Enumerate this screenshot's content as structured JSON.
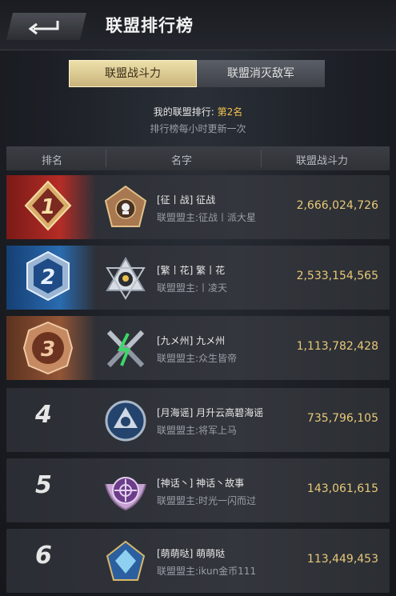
{
  "header": {
    "title": "联盟排行榜"
  },
  "tabs": [
    {
      "label": "联盟战斗力"
    },
    {
      "label": "联盟消灭敌军"
    }
  ],
  "my_rank": {
    "prefix": "我的联盟排行: ",
    "value": "第2名",
    "note": "排行榜每小时更新一次"
  },
  "columns": {
    "rank": "排名",
    "name": "名字",
    "power": "联盟战斗力"
  },
  "rows": [
    {
      "rank": "1",
      "name": "[征丨战] 征战",
      "leader": "联盟盟主:征战丨派大星",
      "power": "2,666,024,726",
      "color": "#c0302c"
    },
    {
      "rank": "2",
      "name": "[繁丨花] 繁丨花",
      "leader": "联盟盟主:丨凌天",
      "power": "2,533,154,565",
      "color": "#2c6fb3"
    },
    {
      "rank": "3",
      "name": "[九メ州] 九メ州",
      "leader": "联盟盟主:众生皆帝",
      "power": "1,113,782,428",
      "color": "#9a5a36"
    },
    {
      "rank": "4",
      "name": "[月海谣] 月升云高碧海谣",
      "leader": "联盟盟主:将军上马",
      "power": "735,796,105"
    },
    {
      "rank": "5",
      "name": "[神话丶] 神话丶故事",
      "leader": "联盟盟主:时光一闪而过",
      "power": "143,061,615"
    },
    {
      "rank": "6",
      "name": "[萌萌哒] 萌萌哒",
      "leader": "联盟盟主:ikun金币111",
      "power": "113,449,453"
    }
  ]
}
